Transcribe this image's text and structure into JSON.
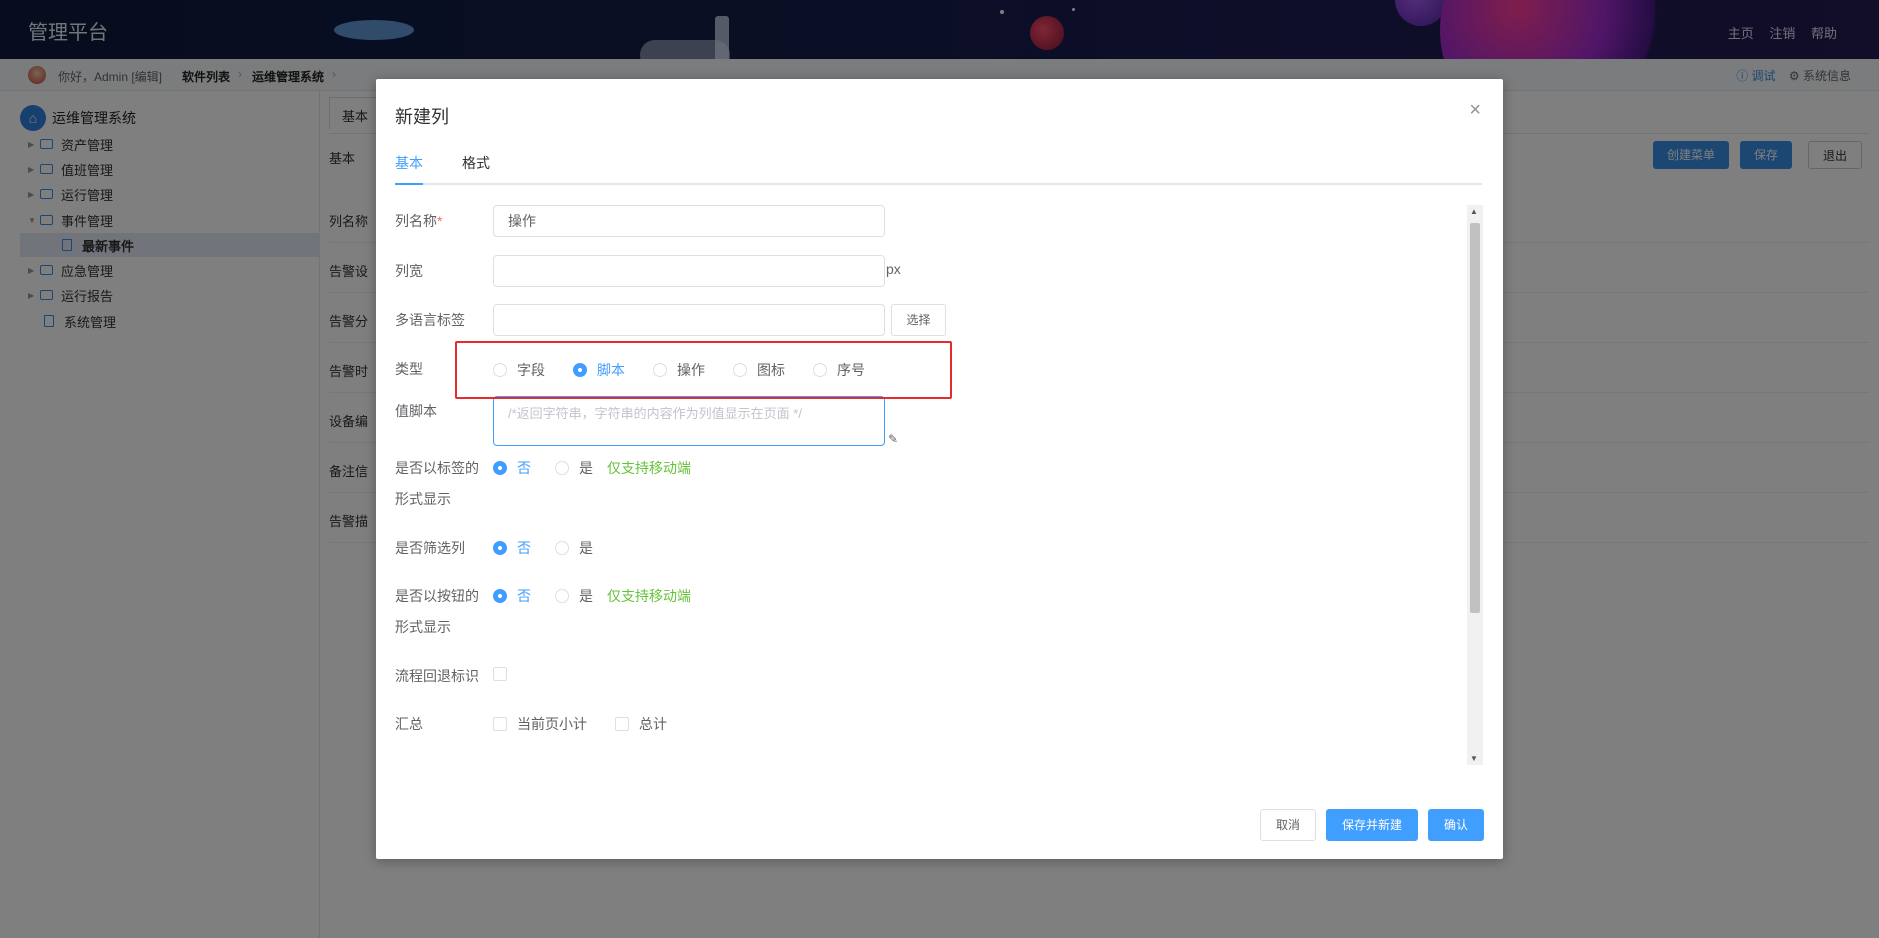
{
  "header": {
    "brand": "管理平台",
    "links": [
      "主页",
      "注销",
      "帮助"
    ]
  },
  "crumb": {
    "greeting": "你好，Admin [编辑]",
    "items": [
      "软件列表",
      "运维管理系统"
    ],
    "debug": "ⓘ 调试",
    "sysinfo": "⚙ 系统信息"
  },
  "sidebar": {
    "root": "运维管理系统",
    "items": [
      {
        "label": "资产管理"
      },
      {
        "label": "值班管理"
      },
      {
        "label": "运行管理"
      },
      {
        "label": "事件管理"
      },
      {
        "label": "最新事件"
      },
      {
        "label": "应急管理"
      },
      {
        "label": "运行报告"
      },
      {
        "label": "系统管理"
      }
    ]
  },
  "main": {
    "tab": "基本",
    "sub": "基本",
    "buttons": {
      "create": "创建菜单",
      "save": "保存",
      "exit": "退出"
    },
    "rows": [
      "列名称",
      "告警设",
      "告警分",
      "告警时",
      "设备编",
      "备注信",
      "告警描"
    ]
  },
  "dialog": {
    "title": "新建列",
    "close": "×",
    "tabs": [
      "基本",
      "格式"
    ],
    "form": {
      "name_label": "列名称",
      "name_req": "*",
      "name_value": "操作",
      "width_label": "列宽",
      "width_unit": "px",
      "i18n_label": "多语言标签",
      "select_btn": "选择",
      "type_label": "类型",
      "type_options": [
        "字段",
        "脚本",
        "操作",
        "图标",
        "序号"
      ],
      "script_label": "值脚本",
      "script_placeholder": "/*返回字符串，字符串的内容作为列值显示在页面 */",
      "tag_label_1": "是否以标签的",
      "tag_label_2": "形式显示",
      "filter_label": "是否筛选列",
      "btn_label_1": "是否以按钮的",
      "btn_label_2": "形式显示",
      "no": "否",
      "yes": "是",
      "mobile_tip": "仅支持移动端",
      "rollback_label": "流程回退标识",
      "summary_label": "汇总",
      "summary_page": "当前页小计",
      "summary_total": "总计"
    },
    "footer": {
      "cancel": "取消",
      "save_new": "保存并新建",
      "confirm": "确认"
    }
  }
}
